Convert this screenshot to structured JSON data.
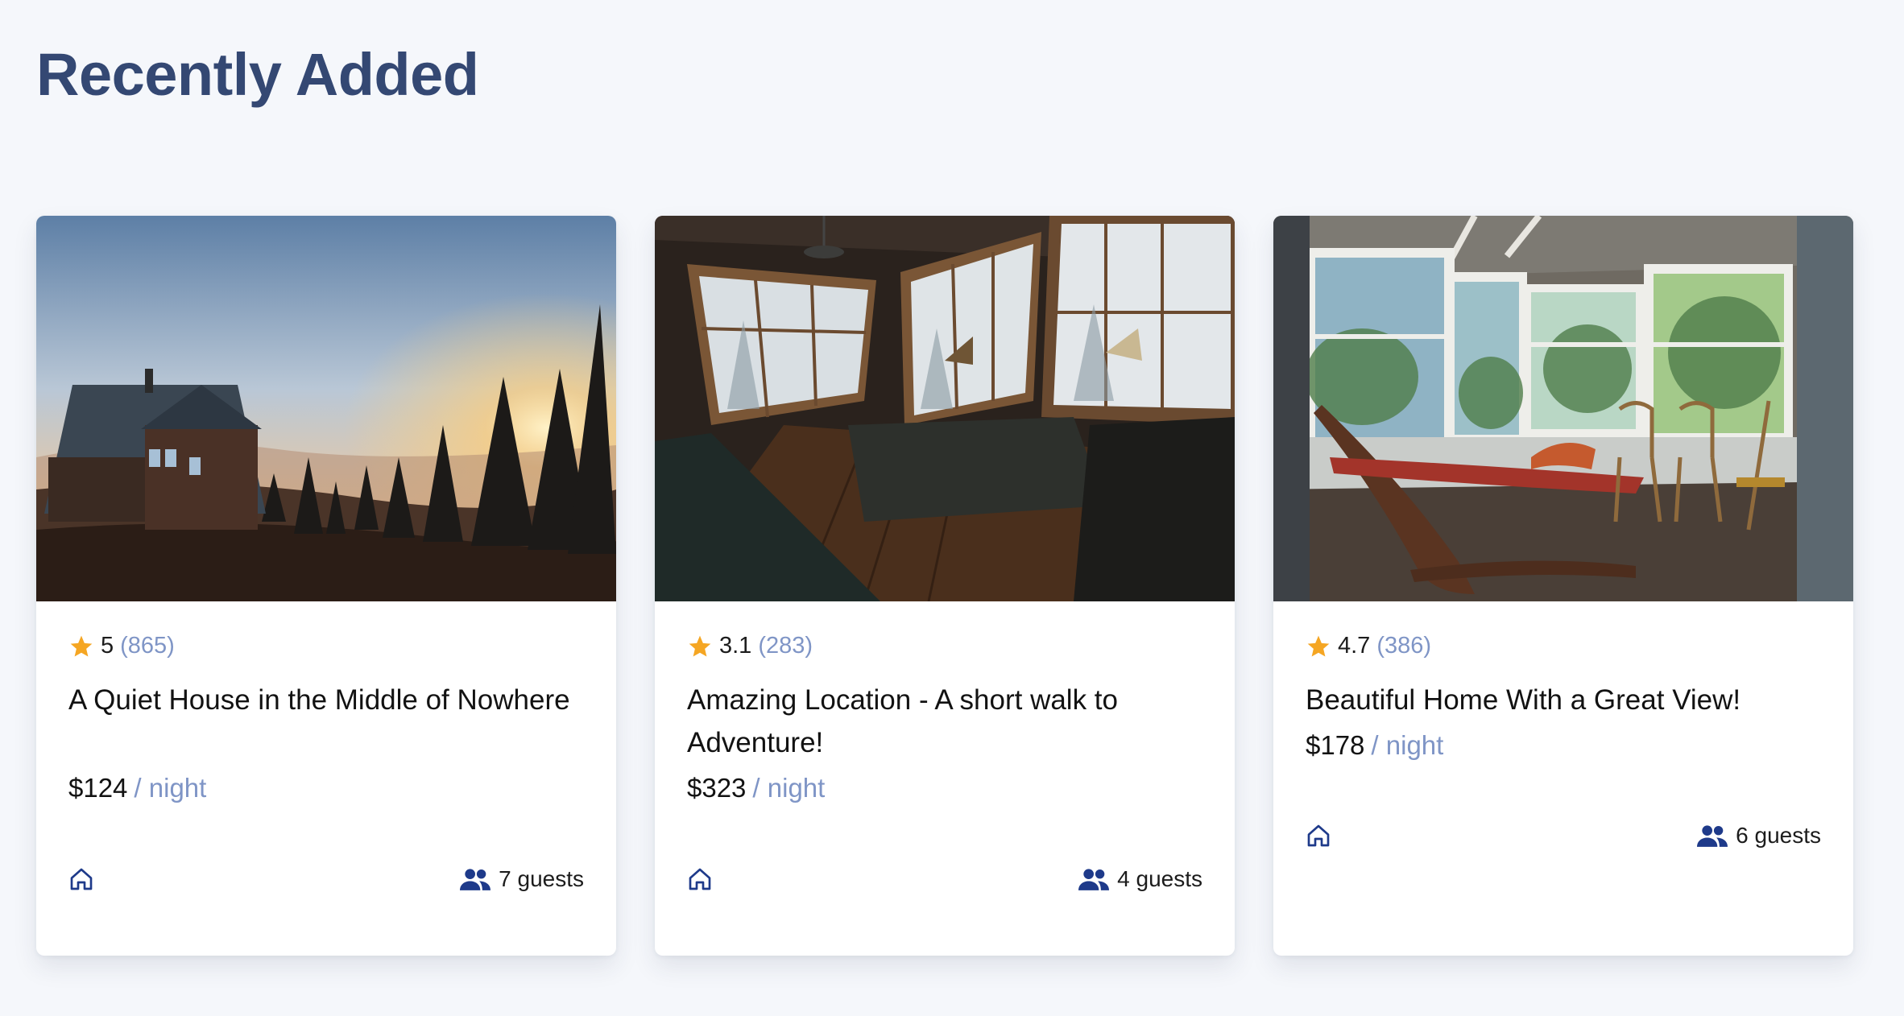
{
  "page": {
    "heading": "Recently Added"
  },
  "listings": [
    {
      "rating": "5",
      "reviews": "(865)",
      "title": "A Quiet House in the Middle of Nowhere",
      "price": "$124",
      "unit": "/ night",
      "guests": "7 guests",
      "image": "cabin-sunset"
    },
    {
      "rating": "3.1",
      "reviews": "(283)",
      "title": "Amazing Location - A short walk to Adventure!",
      "price": "$323",
      "unit": "/ night",
      "guests": "4 guests",
      "image": "cabin-interior"
    },
    {
      "rating": "4.7",
      "reviews": "(386)",
      "title": "Beautiful Home With a Great View!",
      "price": "$178",
      "unit": "/ night",
      "guests": "6 guests",
      "image": "sunroom-hammock"
    }
  ],
  "colors": {
    "heading": "#344873",
    "accent": "#1e3a8a",
    "star": "#f5a623",
    "muted": "#7f95c6"
  },
  "icons": {
    "rating": "star-icon",
    "type": "home-icon",
    "guests": "people-icon"
  }
}
